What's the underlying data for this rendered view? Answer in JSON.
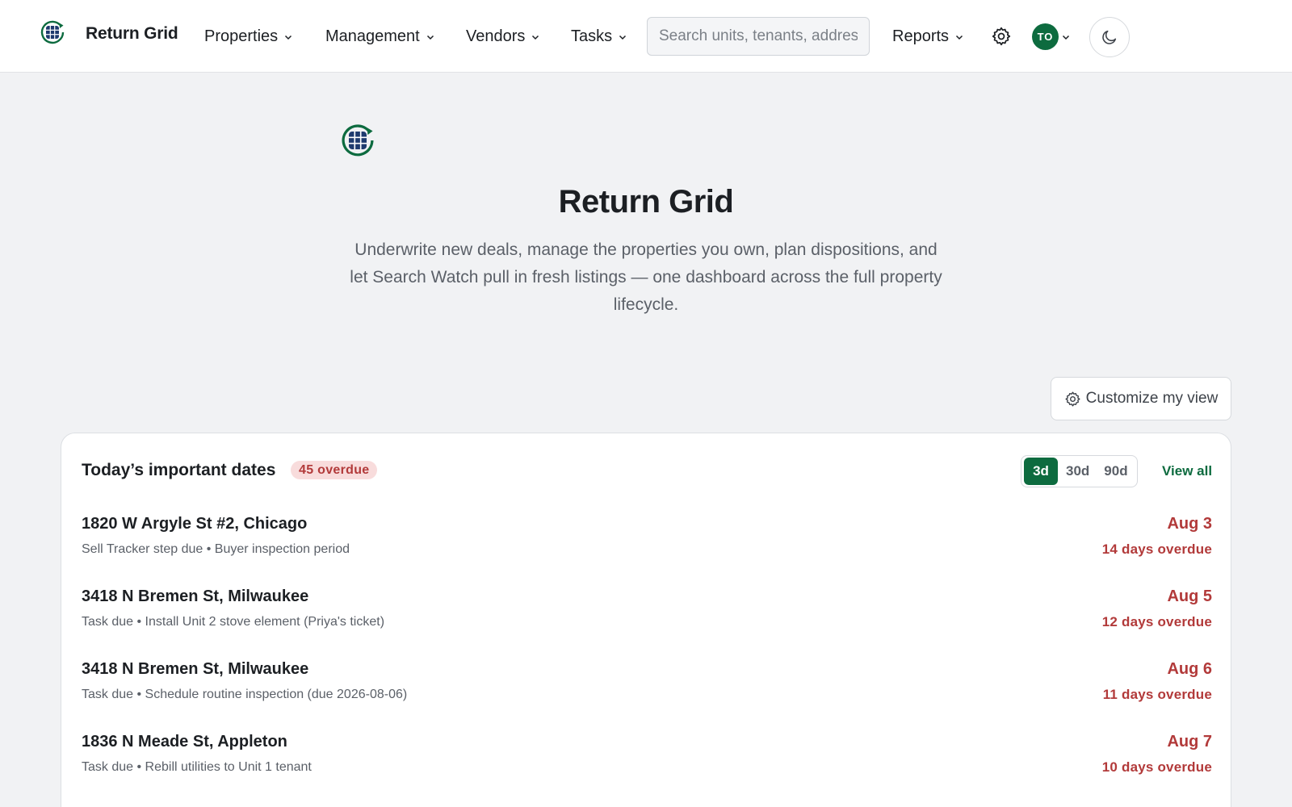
{
  "nav": {
    "brand": "Return Grid",
    "items": [
      {
        "label": "Properties"
      },
      {
        "label": "Management"
      },
      {
        "label": "Vendors"
      },
      {
        "label": "Tasks"
      }
    ],
    "search_placeholder": "Search units, tenants, addresses",
    "reports": "Reports",
    "avatar_initials": "TO"
  },
  "hero": {
    "title": "Return Grid",
    "subtitle": "Underwrite new deals, manage the properties you own, plan dispositions, and let Search Watch pull in fresh listings — one dashboard across the full property lifecycle."
  },
  "customize_label": "Customize my view",
  "dates_card": {
    "title": "Today’s important dates",
    "overdue_badge": "45 overdue",
    "ranges": [
      "3d",
      "30d",
      "90d"
    ],
    "active_range": "3d",
    "view_all": "View all",
    "rows": [
      {
        "address": "1820 W Argyle St #2, Chicago",
        "desc": "Sell Tracker step due • Buyer inspection period",
        "date": "Aug 3",
        "overdue": "14 days overdue"
      },
      {
        "address": "3418 N Bremen St, Milwaukee",
        "desc": "Task due • Install Unit 2 stove element (Priya's ticket)",
        "date": "Aug 5",
        "overdue": "12 days overdue"
      },
      {
        "address": "3418 N Bremen St, Milwaukee",
        "desc": "Task due • Schedule routine inspection (due 2026-08-06)",
        "date": "Aug 6",
        "overdue": "11 days overdue"
      },
      {
        "address": "1836 N Meade St, Appleton",
        "desc": "Task due • Rebill utilities to Unit 1 tenant",
        "date": "Aug 7",
        "overdue": "10 days overdue"
      }
    ]
  },
  "colors": {
    "brand_green": "#0d6b3f",
    "brand_navy": "#1e3a6e",
    "overdue_red": "#b23a3a",
    "background": "#f1f2f4"
  },
  "icons": [
    "grid-logo-icon",
    "chevron-down-icon",
    "gear-icon",
    "moon-icon"
  ]
}
